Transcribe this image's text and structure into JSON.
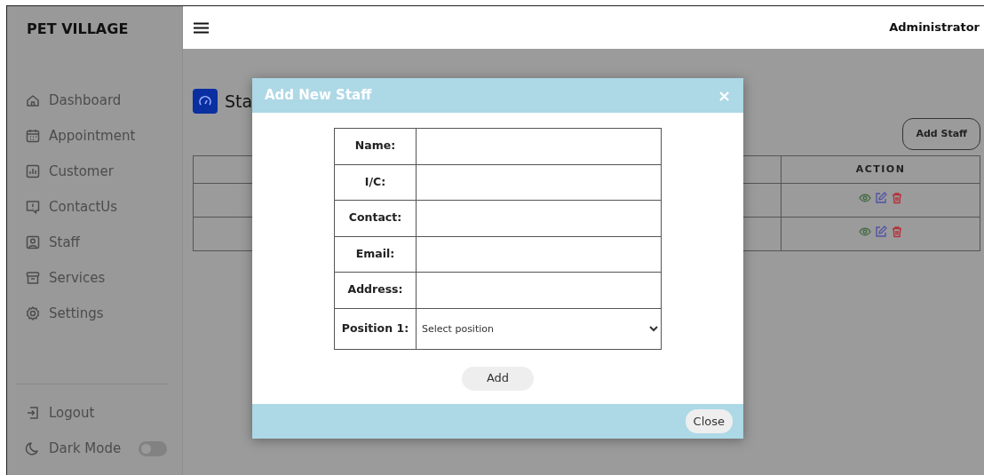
{
  "brand": "PET VILLAGE",
  "sidebar": {
    "items": [
      {
        "label": "Dashboard"
      },
      {
        "label": "Appointment"
      },
      {
        "label": "Customer"
      },
      {
        "label": "ContactUs"
      },
      {
        "label": "Staff"
      },
      {
        "label": "Services"
      },
      {
        "label": "Settings"
      }
    ],
    "bottom": [
      {
        "label": "Logout",
        "kind": "link"
      },
      {
        "label": "Dark Mode",
        "kind": "toggle",
        "on": false
      }
    ]
  },
  "header": {
    "user": "Administrator"
  },
  "page_title": "Sta",
  "add_button": "Add Staff",
  "table": {
    "columns": [
      "ACTION"
    ],
    "rows": [
      {
        "kind": "actions"
      },
      {
        "kind": "actions"
      }
    ]
  },
  "modal": {
    "title": "Add New Staff",
    "close_symbol": "×",
    "fields": [
      {
        "label": "Name:",
        "kind": "input"
      },
      {
        "label": "I/C:",
        "kind": "input"
      },
      {
        "label": "Contact:",
        "kind": "input"
      },
      {
        "label": "Email:",
        "kind": "input"
      },
      {
        "label": "Address:",
        "kind": "input"
      },
      {
        "label": "Position 1:",
        "kind": "select",
        "placeholder": "Select position"
      }
    ],
    "submit": "Add",
    "close": "Close"
  }
}
